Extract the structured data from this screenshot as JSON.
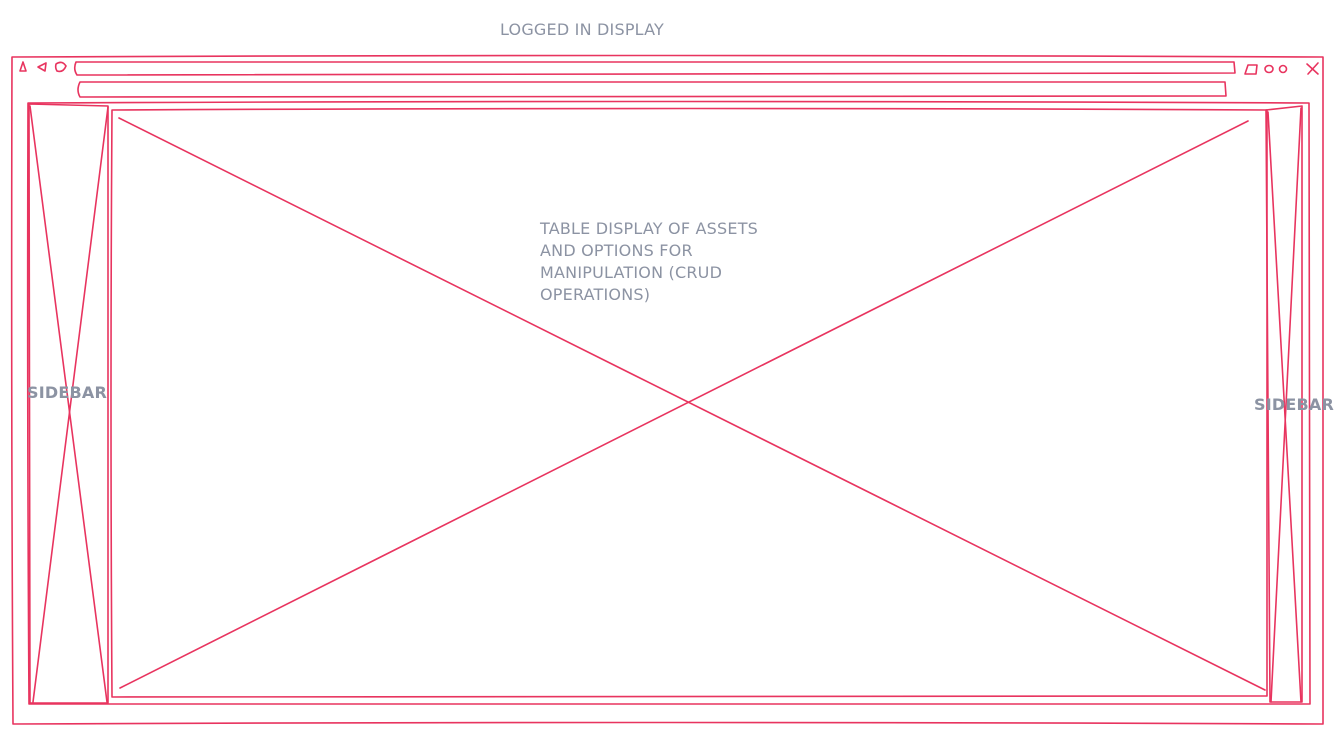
{
  "page_title": "LOGGED IN DISPLAY",
  "main_content": {
    "label": "TABLE DISPLAY OF ASSETS AND OPTIONS FOR MANIPULATION (CRUD OPERATIONS)"
  },
  "left_sidebar": {
    "label": "SIDEBAR"
  },
  "right_sidebar": {
    "label": "SIDEBAR"
  },
  "colors": {
    "stroke": "#e8345f",
    "label_text": "#8c93a3"
  }
}
